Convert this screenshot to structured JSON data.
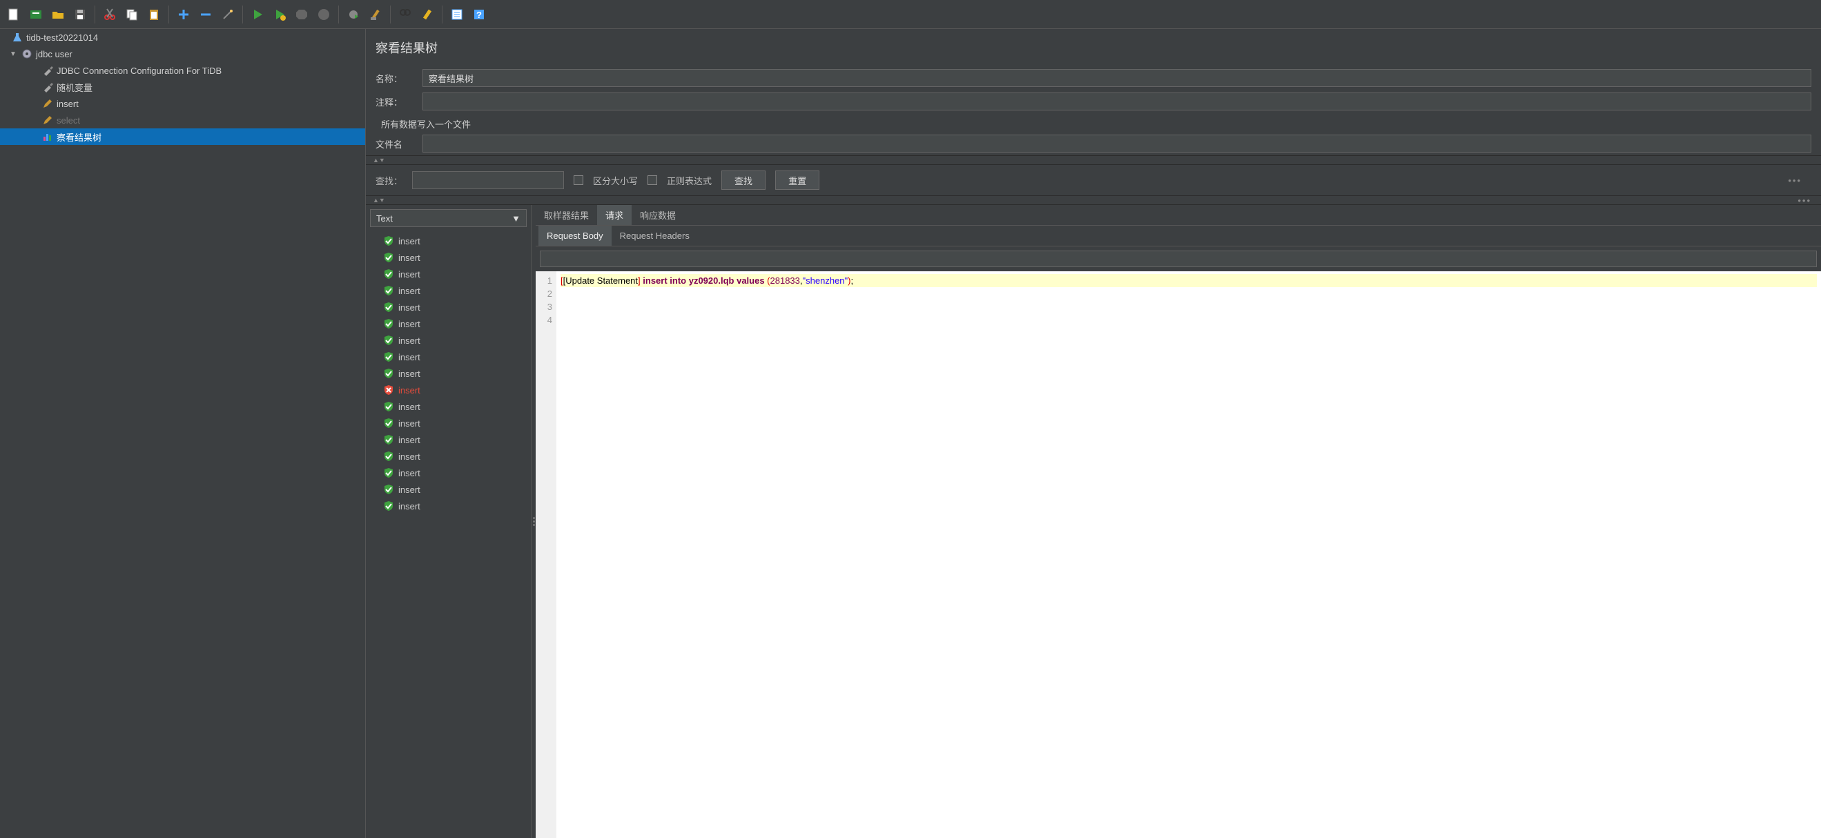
{
  "tree": {
    "root": "tidb-test20221014",
    "thread_group": "jdbc user",
    "items": [
      {
        "label": "JDBC Connection Configuration For TiDB",
        "icon": "wrench"
      },
      {
        "label": "随机变量",
        "icon": "wrench"
      },
      {
        "label": "insert",
        "icon": "pencil"
      },
      {
        "label": "select",
        "icon": "pencil",
        "disabled": true
      },
      {
        "label": "察看结果树",
        "icon": "chart",
        "selected": true
      }
    ]
  },
  "panel": {
    "title": "察看结果树",
    "name_label": "名称：",
    "name_value": "察看结果树",
    "comment_label": "注释：",
    "comment_value": "",
    "write_all_label": "所有数据写入一个文件",
    "filename_label": "文件名",
    "filename_value": ""
  },
  "search": {
    "label": "查找：",
    "value": "",
    "case_label": "区分大小写",
    "regex_label": "正则表达式",
    "find_btn": "查找",
    "reset_btn": "重置"
  },
  "renderer": {
    "selected": "Text"
  },
  "results": [
    {
      "label": "insert",
      "status": "ok"
    },
    {
      "label": "insert",
      "status": "ok"
    },
    {
      "label": "insert",
      "status": "ok"
    },
    {
      "label": "insert",
      "status": "ok"
    },
    {
      "label": "insert",
      "status": "ok"
    },
    {
      "label": "insert",
      "status": "ok"
    },
    {
      "label": "insert",
      "status": "ok"
    },
    {
      "label": "insert",
      "status": "ok"
    },
    {
      "label": "insert",
      "status": "ok"
    },
    {
      "label": "insert",
      "status": "fail"
    },
    {
      "label": "insert",
      "status": "ok"
    },
    {
      "label": "insert",
      "status": "ok"
    },
    {
      "label": "insert",
      "status": "ok"
    },
    {
      "label": "insert",
      "status": "ok"
    },
    {
      "label": "insert",
      "status": "ok"
    },
    {
      "label": "insert",
      "status": "ok"
    },
    {
      "label": "insert",
      "status": "ok"
    }
  ],
  "tabs": {
    "primary": [
      "取样器结果",
      "请求",
      "响应数据"
    ],
    "primary_active": 1,
    "secondary": [
      "Request Body",
      "Request Headers"
    ],
    "secondary_active": 0
  },
  "code": {
    "lines": [
      "1",
      "2",
      "3",
      "4"
    ],
    "prefix": "[Update Statement",
    "bracket_l": "[",
    "bracket_r": "]",
    "sql_kw": " insert into yz0920.lqb values ",
    "paren_l": "(",
    "num": "281833",
    "comma": ",",
    "str": "\"shenzhen\"",
    "paren_r": ")",
    "semi": ";"
  }
}
